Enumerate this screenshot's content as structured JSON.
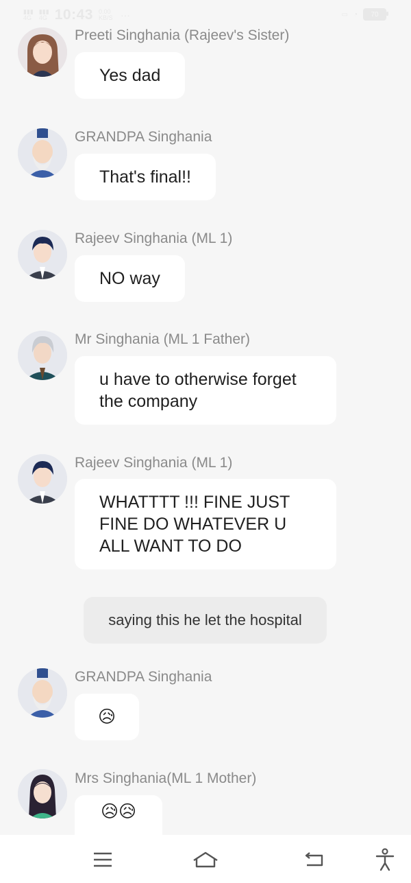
{
  "status_bar": {
    "time": "10:43",
    "net_speed": "0.00 KB/S",
    "network_labels": [
      "4G",
      "4G"
    ],
    "battery": "70"
  },
  "messages": [
    {
      "sender": "Preeti Singhania (Rajeev's Sister)",
      "text": "Yes dad",
      "avatar": "girl-brown-hair-avatar"
    },
    {
      "sender": "GRANDPA Singhania",
      "text": "That's final!!",
      "avatar": "old-man-beard-avatar"
    },
    {
      "sender": "Rajeev Singhania (ML 1)",
      "text": "NO way",
      "avatar": "young-man-suit-avatar"
    },
    {
      "sender": "Mr Singhania (ML 1 Father)",
      "text": "u have to otherwise forget the company",
      "avatar": "grey-hair-man-avatar"
    },
    {
      "sender": "Rajeev Singhania (ML 1)",
      "text": "WHATTTT !!! FINE JUST FINE DO WHATEVER U ALL WANT TO DO",
      "avatar": "young-man-suit-avatar"
    },
    {
      "sender": "GRANDPA Singhania",
      "text": "😥",
      "avatar": "old-man-beard-avatar"
    },
    {
      "sender": "Mrs Singhania(ML 1 Mother)",
      "text": "😥😥",
      "avatar": "woman-dark-hair-avatar"
    }
  ],
  "narration": "saying this he let the hospital",
  "colors": {
    "background": "#f6f6f6",
    "bubble": "#ffffff",
    "narration_bubble": "#ececec",
    "sender_name": "#8a8a8a"
  },
  "nav_bar": {
    "icons": [
      "menu-icon",
      "home-icon",
      "back-icon",
      "accessibility-icon"
    ]
  }
}
